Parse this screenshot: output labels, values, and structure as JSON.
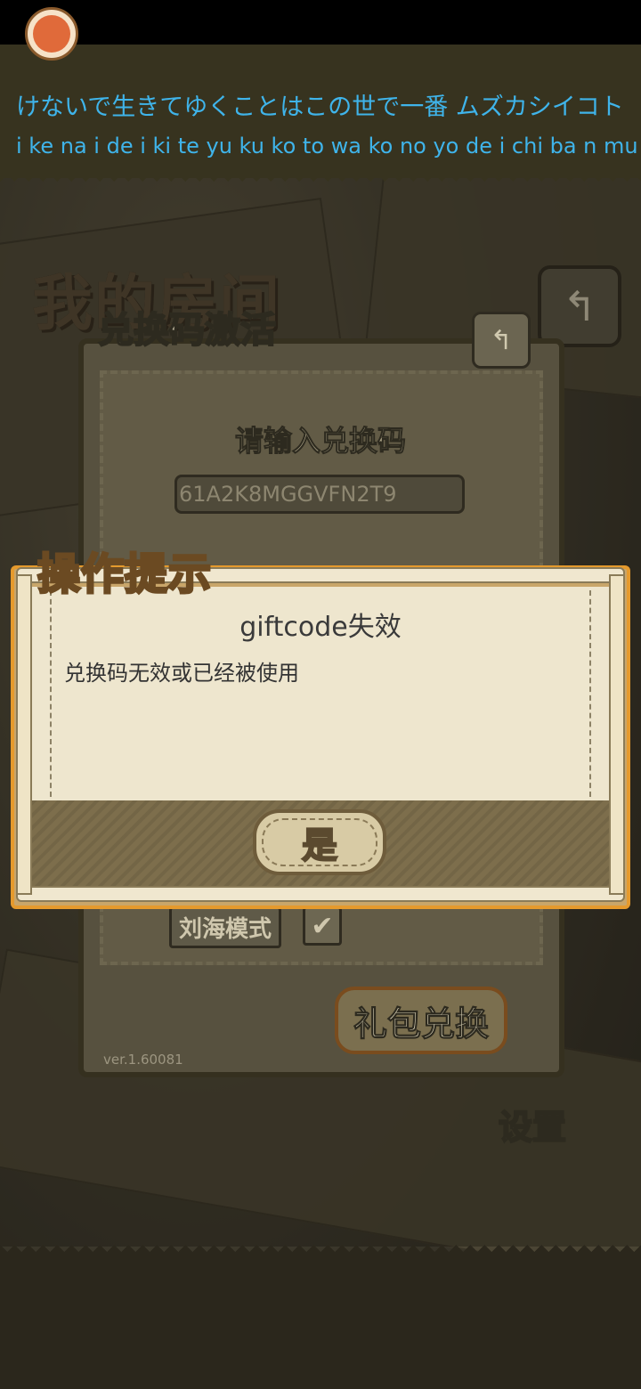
{
  "lyrics": {
    "line1": "けないで生きてゆくことはこの世で一番 ムズカシイコト",
    "line2": "i ke na i de i ki te yu ku ko to wa ko no yo de i chi ba n mu"
  },
  "background": {
    "title": "我的房间",
    "back_glyph": "↰",
    "settings_label": "设置"
  },
  "redeem_panel": {
    "title": "兑换码激活",
    "back_glyph": "↰",
    "prompt": "请输入兑换码",
    "code_value": "61A2K8MGGVFN2T9",
    "notch_mode_label": "刘海模式",
    "notch_mode_checked": "✔",
    "gift_button": "礼包兑换",
    "version": "ver.1.60081"
  },
  "dialog": {
    "tab_title": "操作提示",
    "heading": "giftcode失效",
    "message": "兑换码无效或已经被使用",
    "yes_button": "是"
  },
  "colors": {
    "lyrics_text": "#3fb4ea",
    "dialog_border": "#e59a2d"
  }
}
